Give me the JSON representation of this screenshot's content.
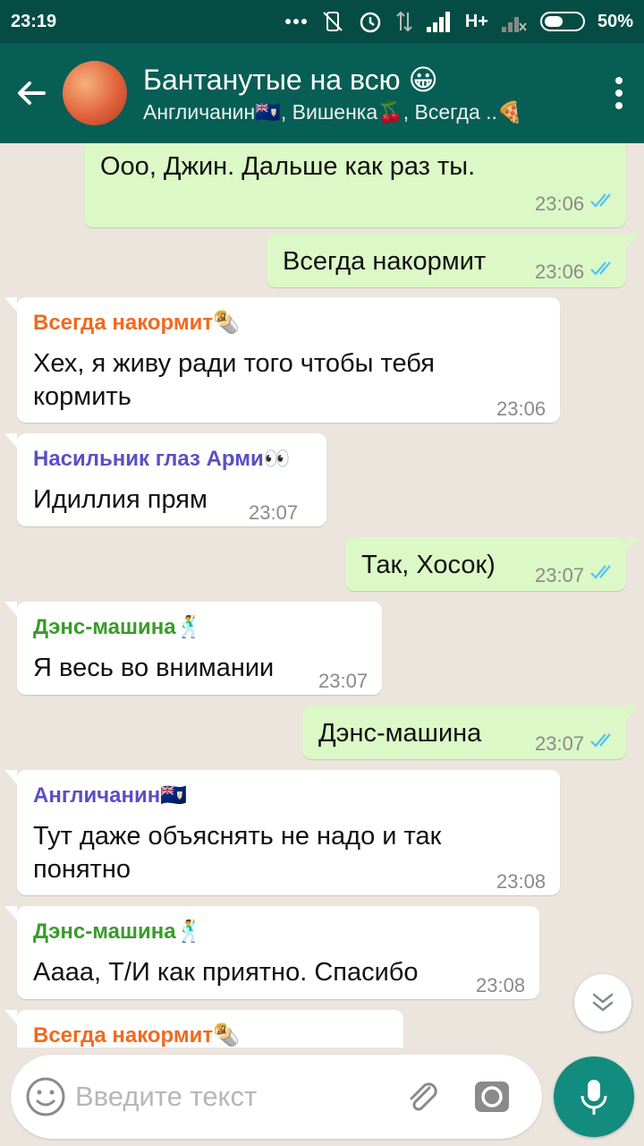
{
  "status_bar": {
    "time": "23:19",
    "network": "H+",
    "battery": "50%",
    "battery_level": 0.5
  },
  "header": {
    "title": "Бантанутые на всю 😀",
    "subtitle": "Англичанин🇦🇮, Вишенка🍒, Всегда ..🍕"
  },
  "messages": [
    {
      "kind": "out",
      "text": "Ооо, Джин. Дальше как раз ты.",
      "time": "23:06"
    },
    {
      "kind": "out",
      "text": "Всегда накормит",
      "time": "23:06"
    },
    {
      "kind": "in",
      "sender": "Всегда накормит🌯",
      "sender_color": "#f06a1f",
      "text": "Хех, я живу ради того чтобы тебя кормить",
      "time": "23:06"
    },
    {
      "kind": "in",
      "sender": "Насильник глаз Арми👀",
      "sender_color": "#5b4fc4",
      "text": "Идиллия прям",
      "time": "23:07"
    },
    {
      "kind": "out",
      "text": "Так, Хосок)",
      "time": "23:07"
    },
    {
      "kind": "in",
      "sender": "Дэнс-машина🕺",
      "sender_color": "#3a9b2b",
      "text": "Я весь во внимании",
      "time": "23:07"
    },
    {
      "kind": "out",
      "text": "Дэнс-машина",
      "time": "23:07"
    },
    {
      "kind": "in",
      "sender": "Англичанин🇦🇮",
      "sender_color": "#5b4fc4",
      "text": "Тут даже объяснять не надо и так понятно",
      "time": "23:08"
    },
    {
      "kind": "in",
      "sender": "Дэнс-машина🕺",
      "sender_color": "#3a9b2b",
      "text": "Аааа, Т/И как приятно. Спасибо",
      "time": "23:08"
    },
    {
      "kind": "in",
      "sender": "Всегда накормит🌯",
      "sender_color": "#f06a1f",
      "text": "",
      "time": ""
    }
  ],
  "composer": {
    "placeholder": "Введите текст"
  },
  "colors": {
    "header": "#075e54",
    "status_bar": "#054d44",
    "outgoing_bubble": "#dcf8c6",
    "read_ticks": "#4fc3f7",
    "mic_button": "#128c7e"
  }
}
